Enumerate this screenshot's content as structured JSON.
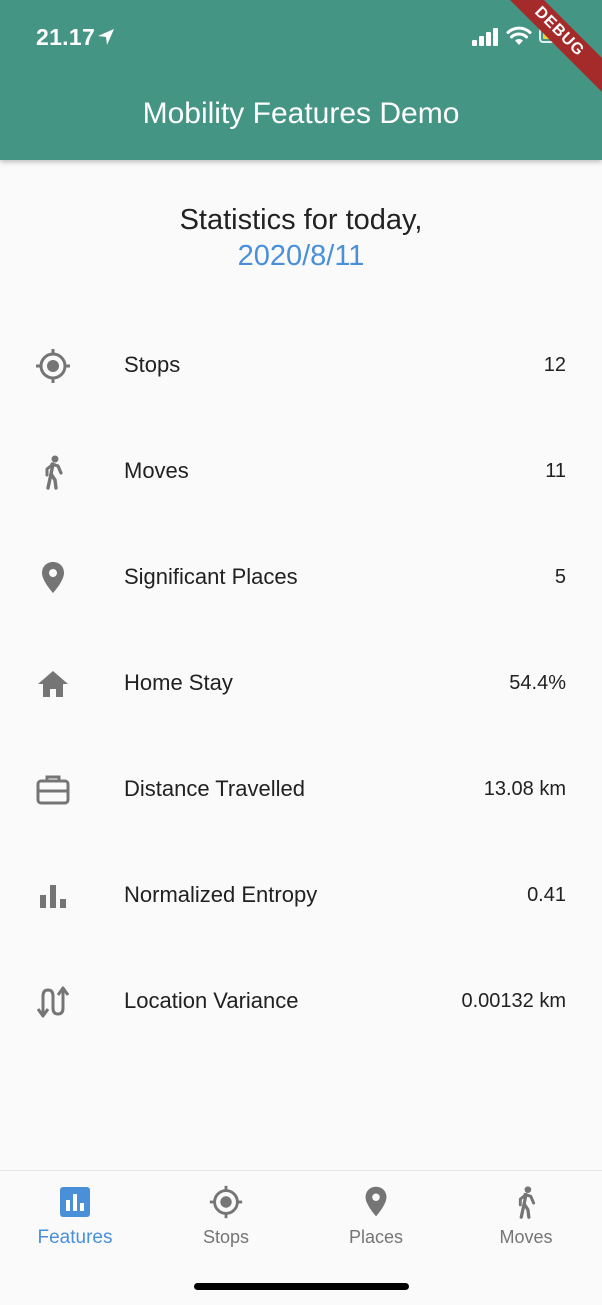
{
  "status_bar": {
    "time": "21.17",
    "debug_banner": "DEBUG"
  },
  "app": {
    "title": "Mobility Features Demo"
  },
  "heading": {
    "title": "Statistics for today,",
    "date": "2020/8/11"
  },
  "colors": {
    "appbar": "#459585",
    "accent": "#4a90d9",
    "icon": "#757575"
  },
  "stats": [
    {
      "icon": "stop-target-icon",
      "label": "Stops",
      "value": "12"
    },
    {
      "icon": "walking-person-icon",
      "label": "Moves",
      "value": "11"
    },
    {
      "icon": "map-pin-icon",
      "label": "Significant Places",
      "value": "5"
    },
    {
      "icon": "home-icon",
      "label": "Home Stay",
      "value": "54.4%"
    },
    {
      "icon": "briefcase-icon",
      "label": "Distance Travelled",
      "value": "13.08 km"
    },
    {
      "icon": "bar-chart-icon",
      "label": "Normalized Entropy",
      "value": "0.41"
    },
    {
      "icon": "swap-vertical-icon",
      "label": "Location Variance",
      "value": "0.00132 km"
    }
  ],
  "bottom_nav": [
    {
      "label": "Features",
      "icon": "bar-chart-icon",
      "active": true
    },
    {
      "label": "Stops",
      "icon": "stop-target-icon",
      "active": false
    },
    {
      "label": "Places",
      "icon": "map-pin-icon",
      "active": false
    },
    {
      "label": "Moves",
      "icon": "walking-person-icon",
      "active": false
    }
  ]
}
